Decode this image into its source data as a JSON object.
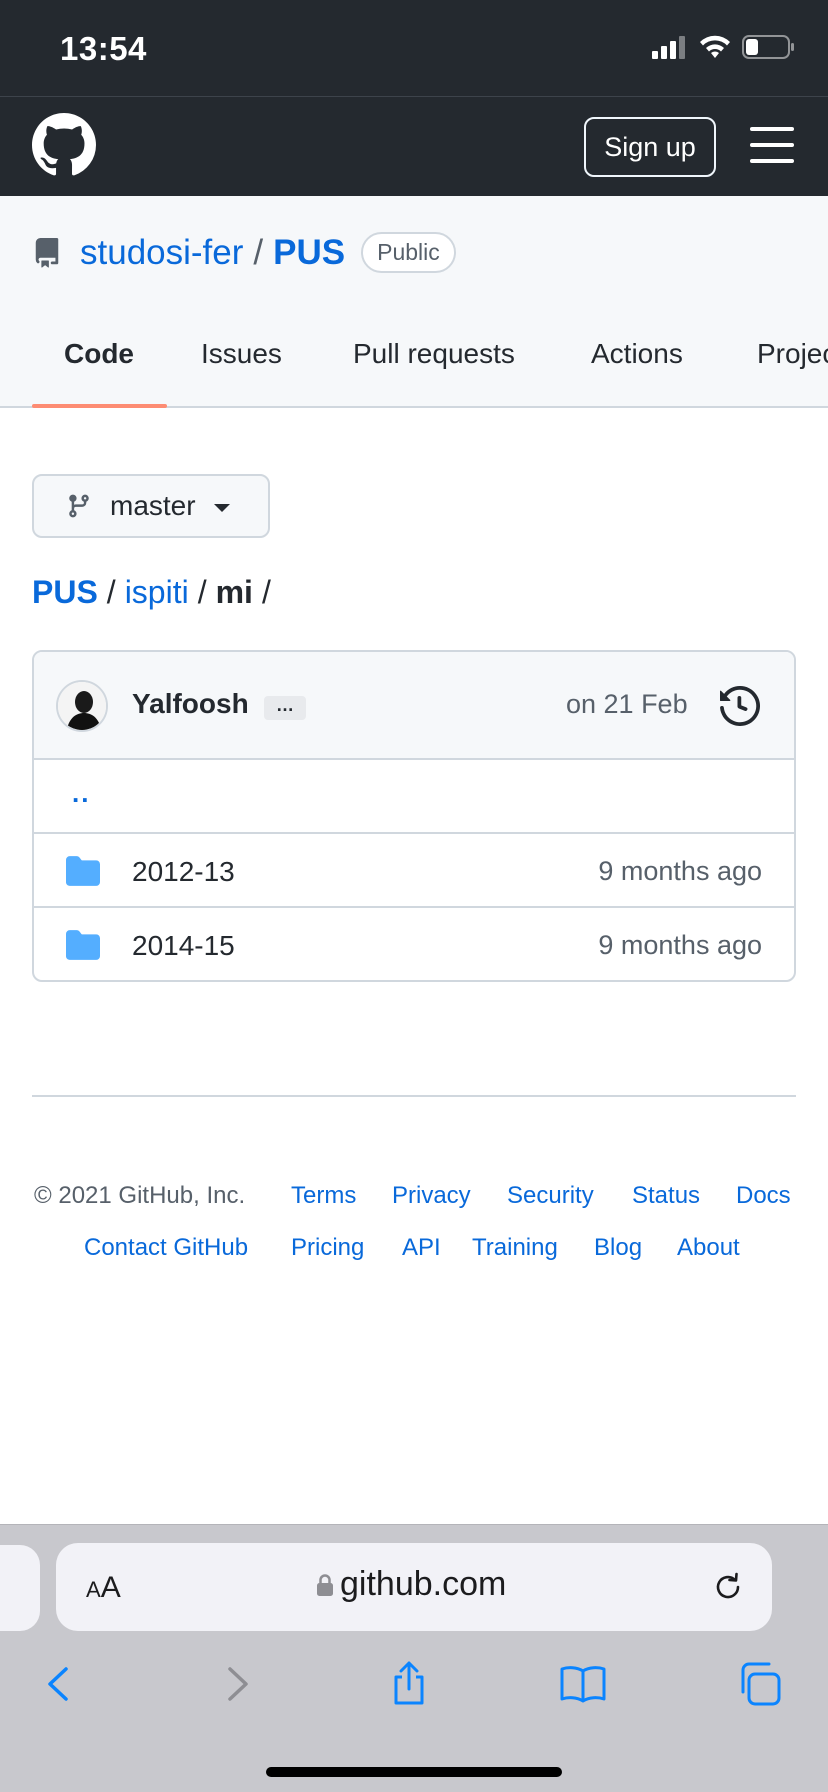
{
  "status_bar": {
    "time": "13:54"
  },
  "header": {
    "signup_label": "Sign up"
  },
  "repo": {
    "owner": "studosi-fer",
    "separator": "/",
    "name": "PUS",
    "visibility": "Public"
  },
  "tabs": [
    {
      "label": "Code",
      "active": true
    },
    {
      "label": "Issues"
    },
    {
      "label": "Pull requests"
    },
    {
      "label": "Actions"
    },
    {
      "label": "Projec"
    }
  ],
  "branch": {
    "label": "master"
  },
  "breadcrumb": {
    "repo": "PUS",
    "sep": "/",
    "folder": "ispiti",
    "current": "mi",
    "trailing": "/"
  },
  "commit": {
    "author": "Yalfoosh",
    "ellipsis": "…",
    "date": "on 21 Feb"
  },
  "files": {
    "parent": "..",
    "items": [
      {
        "name": "2012-13",
        "age": "9 months ago"
      },
      {
        "name": "2014-15",
        "age": "9 months ago"
      }
    ]
  },
  "footer": {
    "copyright": "© 2021 GitHub, Inc.",
    "links_row1": [
      "Terms",
      "Privacy",
      "Security",
      "Status",
      "Docs"
    ],
    "links_row2": [
      "Contact GitHub",
      "Pricing",
      "API",
      "Training",
      "Blog",
      "About"
    ]
  },
  "browser": {
    "aa_label_small": "A",
    "aa_label_big": "A",
    "url": "github.com"
  },
  "colors": {
    "header_bg": "#24292f",
    "link": "#0969da",
    "tab_underline": "#fd8c73",
    "folder": "#54aeff"
  }
}
